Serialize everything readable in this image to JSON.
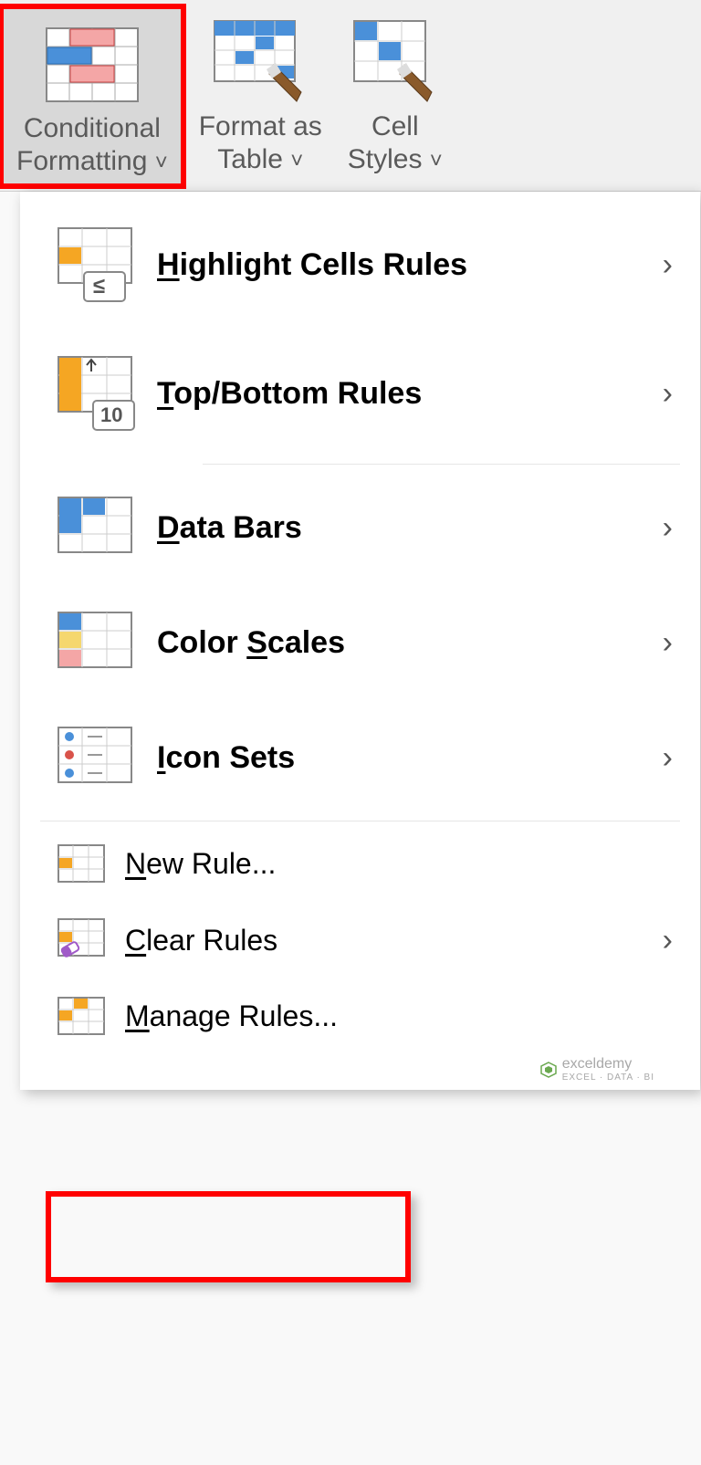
{
  "ribbon": {
    "conditional_formatting": "Conditional\nFormatting",
    "format_as_table": "Format as\nTable",
    "cell_styles": "Cell\nStyles"
  },
  "menu": {
    "highlight_cells": "ighlight Cells Rules",
    "top_bottom": "op/Bottom Rules",
    "data_bars": "ata Bars",
    "color_scales": "Color ",
    "color_scales2": "cales",
    "icon_sets": "con Sets",
    "new_rule": "ew Rule...",
    "clear_rules": "lear Rules",
    "manage_rules": "anage Rules..."
  },
  "watermark": {
    "name": "exceldemy",
    "tag": "EXCEL · DATA · BI"
  }
}
